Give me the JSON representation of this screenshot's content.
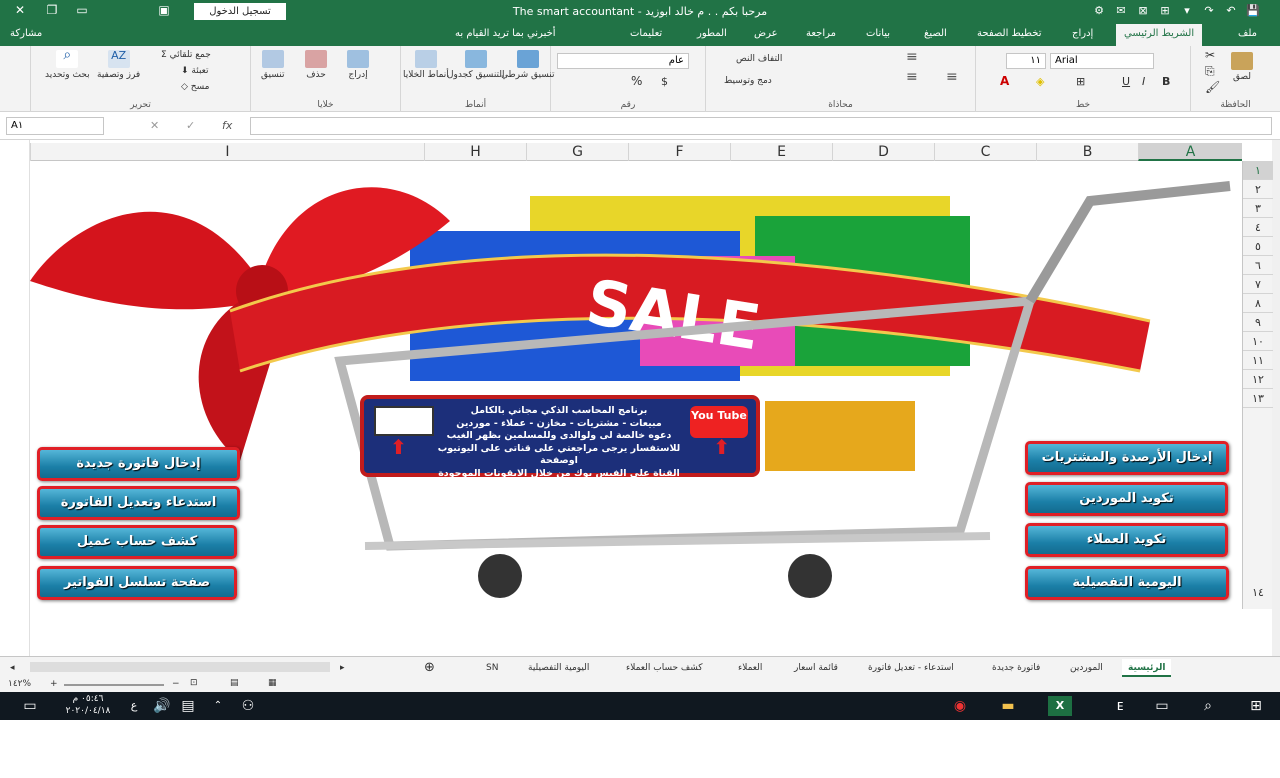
{
  "titlebar": {
    "title": "The smart accountant   -   مرحبا بكم . . م خالد ابوزيد",
    "signin": "تسجيل الدخول"
  },
  "tabs": {
    "share": "مشاركة",
    "tellme": "أخبرني بما تريد القيام به",
    "items": [
      "ملف",
      "الشريط الرئيسي",
      "إدراج",
      "تخطيط الصفحة",
      "الصيغ",
      "بيانات",
      "مراجعة",
      "عرض",
      "المطور",
      "تعليمات"
    ]
  },
  "ribbon": {
    "groups": {
      "clipboard": "الحافظة",
      "font": "خط",
      "alignment": "محاذاة",
      "number": "رقم",
      "styles": "أنماط",
      "cells": "خلايا",
      "editing": "تحرير"
    },
    "paste": "لصق",
    "font_name": "Arial",
    "font_size": "١١",
    "wrap_text": "التفاف النص",
    "merge_center": "دمج وتوسيط",
    "number_format": "عام",
    "conditional": "تنسيق شرطي",
    "format_table": "التنسيق كجدول",
    "cell_styles": "أنماط الخلايا",
    "insert": "إدراج",
    "delete": "حذف",
    "format": "تنسيق",
    "autosum": "جمع تلقائي",
    "fill": "تعبئة",
    "clear": "مسح",
    "sort_filter": "فرز وتصفية",
    "find_select": "بحث وتحديد"
  },
  "formula_bar": {
    "namebox": "A١",
    "fx": "fx"
  },
  "columns": [
    "A",
    "B",
    "C",
    "D",
    "E",
    "F",
    "G",
    "H",
    "I"
  ],
  "rows": [
    "١",
    "٢",
    "٣",
    "٤",
    "٥",
    "٦",
    "٧",
    "٨",
    "٩",
    "١٠",
    "١١",
    "١٢",
    "١٣",
    "١٤"
  ],
  "sheet_art": {
    "sale": "SALE",
    "promo_lines": [
      "برنامج المحاسب الذكي مجاني بالكامل",
      "مبيعات - مشتريات - مخازن - عملاء - موردين",
      "دعوه خالصة لى ولوالدى وللمسلمين بظهر الغيب",
      "للاستفسار يرجى مراجعتي على قناتى على اليوتيوب اوصفحة",
      "القناة على الفيس بوك من خلال الايقونات الموجودة امامك"
    ],
    "youtube": "You Tube"
  },
  "buttons_left": [
    "إدخال فاتورة جديدة",
    "استدعاء وتعديل الفاتورة",
    "كشف حساب عميل",
    "صفحة تسلسل الفواتير"
  ],
  "buttons_right": [
    "إدخال الأرصدة والمشتريات",
    "تكويد الموردين",
    "تكويد العملاء",
    "اليومية التفصيلية"
  ],
  "sheet_tabs": [
    "الرئيسية",
    "الموردين",
    "فاتورة جديدة",
    "استدعاء - تعديل فاتورة",
    "قائمة اسعار",
    "العملاء",
    "كشف حساب العملاء",
    "اليومية التفصيلية",
    "SN"
  ],
  "status": {
    "zoom": "١٤٢%"
  },
  "taskbar": {
    "time": "٠٥:٤٦ م",
    "date": "٢٠٢٠/٠٤/١٨",
    "lang": "ع"
  }
}
